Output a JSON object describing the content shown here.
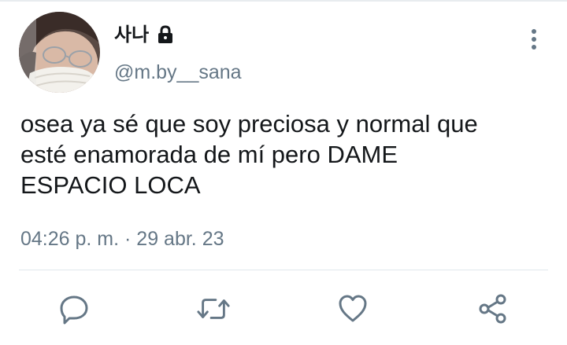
{
  "user": {
    "display_name": "사나",
    "handle": "@m.by__sana",
    "locked": true,
    "avatar_icon": "profile-photo"
  },
  "tweet": {
    "text": "osea ya sé que soy preciosa y normal que\nesté enamorada de mí pero DAME\nESPACIO LOCA",
    "timestamp": "04:26 p. m. · 29 abr. 23"
  },
  "actions": [
    {
      "name": "reply",
      "icon": "reply-bubble-icon"
    },
    {
      "name": "retweet",
      "icon": "retweet-icon"
    },
    {
      "name": "like",
      "icon": "heart-icon"
    },
    {
      "name": "share",
      "icon": "share-icon"
    }
  ],
  "colors": {
    "text_primary": "#14171a",
    "text_secondary": "#657786",
    "icon": "#657786",
    "divider": "#e1e8ed"
  }
}
